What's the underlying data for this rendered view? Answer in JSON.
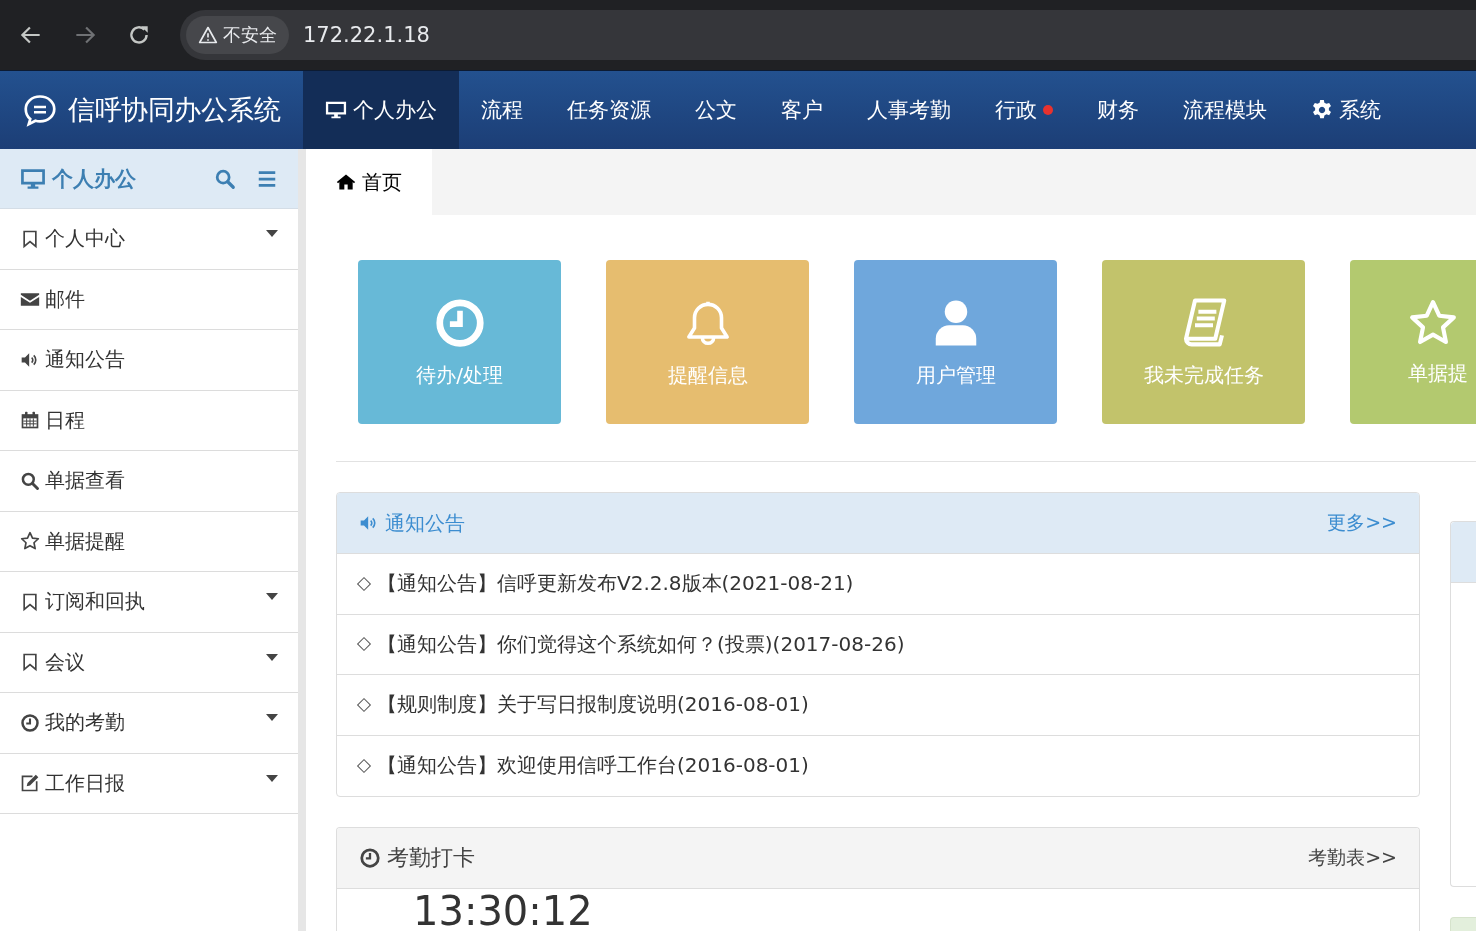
{
  "browser": {
    "security": "不安全",
    "address": "172.22.1.18"
  },
  "app": {
    "title": "信呼协同办公系统"
  },
  "nav": [
    {
      "label": "个人办公",
      "kind": "monitor",
      "selected": true,
      "badge": false
    },
    {
      "label": "流程",
      "kind": "plain",
      "selected": false,
      "badge": false
    },
    {
      "label": "任务资源",
      "kind": "plain",
      "selected": false,
      "badge": false
    },
    {
      "label": "公文",
      "kind": "plain",
      "selected": false,
      "badge": false
    },
    {
      "label": "客户",
      "kind": "plain",
      "selected": false,
      "badge": false
    },
    {
      "label": "人事考勤",
      "kind": "plain",
      "selected": false,
      "badge": false
    },
    {
      "label": "行政",
      "kind": "plain",
      "selected": false,
      "badge": true
    },
    {
      "label": "财务",
      "kind": "plain",
      "selected": false,
      "badge": false
    },
    {
      "label": "流程模块",
      "kind": "plain",
      "selected": false,
      "badge": false
    },
    {
      "label": "系统",
      "kind": "gear",
      "selected": false,
      "badge": false
    }
  ],
  "sidebar": {
    "title": "个人办公",
    "items": [
      {
        "label": "个人中心",
        "kind": "bookmark",
        "expandable": true
      },
      {
        "label": "邮件",
        "kind": "envelope",
        "expandable": false
      },
      {
        "label": "通知公告",
        "kind": "volume",
        "expandable": false
      },
      {
        "label": "日程",
        "kind": "calendar",
        "expandable": false
      },
      {
        "label": "单据查看",
        "kind": "search",
        "expandable": false
      },
      {
        "label": "单据提醒",
        "kind": "star",
        "expandable": false
      },
      {
        "label": "订阅和回执",
        "kind": "bookmark",
        "expandable": true
      },
      {
        "label": "会议",
        "kind": "bookmark",
        "expandable": true
      },
      {
        "label": "我的考勤",
        "kind": "clock",
        "expandable": true
      },
      {
        "label": "工作日报",
        "kind": "edit",
        "expandable": true
      }
    ]
  },
  "tabs": [
    {
      "label": "首页",
      "selected": true
    }
  ],
  "tiles": [
    {
      "label": "待办/处理",
      "kind": "clock",
      "color": "#67b9d7"
    },
    {
      "label": "提醒信息",
      "kind": "bell",
      "color": "#e6bd6f"
    },
    {
      "label": "用户管理",
      "kind": "user",
      "color": "#6fa7dc"
    },
    {
      "label": "我未完成任务",
      "kind": "book",
      "color": "#c2c36b"
    },
    {
      "label": "单据提",
      "kind": "star",
      "color": "#b3c96f"
    }
  ],
  "notices": {
    "title": "通知公告",
    "more": "更多>>",
    "items": [
      "【通知公告】信呼更新发布V2.2.8版本(2021-08-21)",
      "【通知公告】你们觉得这个系统如何？(投票)(2017-08-26)",
      "【规则制度】关于写日报制度说明(2016-08-01)",
      "【通知公告】欢迎使用信呼工作台(2016-08-01)"
    ]
  },
  "attendance": {
    "title": "考勤打卡",
    "link": "考勤表>>",
    "time": "13:30:12"
  }
}
